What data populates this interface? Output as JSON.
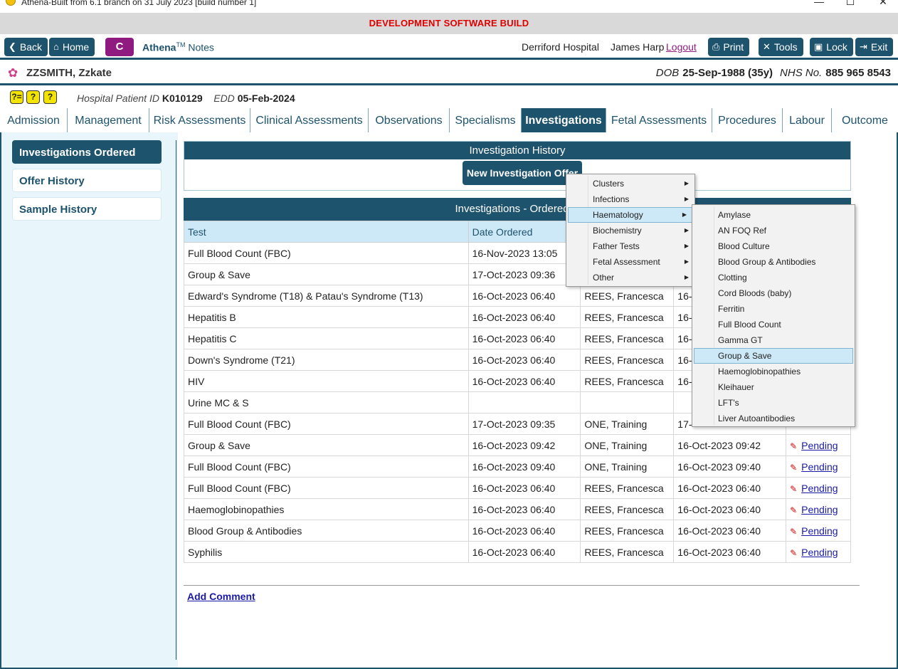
{
  "window": {
    "title": "Athena-Built from 6.1 branch on 31 July 2023 [build number 1]",
    "minimize": "—",
    "maximize": "☐",
    "close": "✕"
  },
  "banner": "DEVELOPMENT SOFTWARE BUILD",
  "toolbar": {
    "back": "Back",
    "home": "Home",
    "c": "C",
    "app_name": "Athena",
    "app_tm": "TM",
    "app_suffix": " Notes",
    "hospital": "Derriford Hospital",
    "user": "James Harp",
    "logout": "Logout",
    "print": "Print",
    "tools": "Tools",
    "lock": "Lock",
    "exit": "Exit"
  },
  "patient": {
    "name": "ZZSMITH, Zzkate",
    "dob_label": "DOB",
    "dob": "25-Sep-1988 (35y)",
    "nhs_label": "NHS No.",
    "nhs": "885 965 8543",
    "pid_label": "Hospital Patient ID",
    "pid": "K010129",
    "edd_label": "EDD",
    "edd": "05-Feb-2024",
    "icons": [
      "?=",
      "?",
      "?"
    ]
  },
  "tabs": [
    {
      "label": "Admission"
    },
    {
      "label": "Management"
    },
    {
      "label": "Risk Assessments"
    },
    {
      "label": "Clinical Assessments"
    },
    {
      "label": "Observations"
    },
    {
      "label": "Specialisms"
    },
    {
      "label": "Investigations"
    },
    {
      "label": "Fetal Assessments"
    },
    {
      "label": "Procedures"
    },
    {
      "label": "Labour"
    },
    {
      "label": "Outcome"
    }
  ],
  "sidebar": {
    "items": [
      {
        "label": "Investigations Ordered"
      },
      {
        "label": "Offer History"
      },
      {
        "label": "Sample History"
      }
    ]
  },
  "history": {
    "header": "Investigation History",
    "new_button": "New Investigation Offer"
  },
  "ordered": {
    "header": "Investigations - Ordered H",
    "columns": [
      "Test",
      "Date Ordered"
    ],
    "rows": [
      {
        "test": "Full Blood Count (FBC)",
        "date": "16-Nov-2023 13:05",
        "by": "",
        "date2": "",
        "status": ""
      },
      {
        "test": "Group & Save",
        "date": "17-Oct-2023 09:36",
        "by": "",
        "date2": "",
        "status": ""
      },
      {
        "test": "Edward's Syndrome (T18) & Patau's Syndrome (T13)",
        "date": "16-Oct-2023 06:40",
        "by": "REES, Francesca",
        "date2": "16-",
        "status": ""
      },
      {
        "test": "Hepatitis B",
        "date": "16-Oct-2023 06:40",
        "by": "REES, Francesca",
        "date2": "16-",
        "status": ""
      },
      {
        "test": "Hepatitis C",
        "date": "16-Oct-2023 06:40",
        "by": "REES, Francesca",
        "date2": "16-",
        "status": ""
      },
      {
        "test": "Down's Syndrome (T21)",
        "date": "16-Oct-2023 06:40",
        "by": "REES, Francesca",
        "date2": "16-",
        "status": ""
      },
      {
        "test": "HIV",
        "date": "16-Oct-2023 06:40",
        "by": "REES, Francesca",
        "date2": "16-",
        "status": ""
      },
      {
        "test": "Urine MC & S",
        "date": "",
        "by": "",
        "date2": "",
        "status": ""
      },
      {
        "test": "Full Blood Count (FBC)",
        "date": "17-Oct-2023 09:35",
        "by": "ONE, Training",
        "date2": "17-",
        "status": ""
      },
      {
        "test": "Group & Save",
        "date": "16-Oct-2023 09:42",
        "by": "ONE, Training",
        "date2": "16-Oct-2023 09:42",
        "status": "Pending"
      },
      {
        "test": "Full Blood Count (FBC)",
        "date": "16-Oct-2023 09:40",
        "by": "ONE, Training",
        "date2": "16-Oct-2023 09:40",
        "status": "Pending"
      },
      {
        "test": "Full Blood Count (FBC)",
        "date": "16-Oct-2023 06:40",
        "by": "REES, Francesca",
        "date2": "16-Oct-2023 06:40",
        "status": "Pending"
      },
      {
        "test": "Haemoglobinopathies",
        "date": "16-Oct-2023 06:40",
        "by": "REES, Francesca",
        "date2": "16-Oct-2023 06:40",
        "status": "Pending"
      },
      {
        "test": "Blood Group & Antibodies",
        "date": "16-Oct-2023 06:40",
        "by": "REES, Francesca",
        "date2": "16-Oct-2023 06:40",
        "status": "Pending"
      },
      {
        "test": "Syphilis",
        "date": "16-Oct-2023 06:40",
        "by": "REES, Francesca",
        "date2": "16-Oct-2023 06:40",
        "status": "Pending"
      }
    ]
  },
  "add_comment": "Add Comment",
  "menu": {
    "items": [
      {
        "label": "Clusters",
        "submenu": true
      },
      {
        "label": "Infections",
        "submenu": true
      },
      {
        "label": "Haematology",
        "submenu": true,
        "hover": true
      },
      {
        "label": "Biochemistry",
        "submenu": true
      },
      {
        "label": "Father Tests",
        "submenu": true
      },
      {
        "label": "Fetal Assessment",
        "submenu": true
      },
      {
        "label": "Other",
        "submenu": true
      }
    ],
    "submenu_items": [
      {
        "label": "Amylase"
      },
      {
        "label": "AN FOQ Ref"
      },
      {
        "label": "Blood Culture"
      },
      {
        "label": "Blood Group & Antibodies"
      },
      {
        "label": "Clotting"
      },
      {
        "label": "Cord Bloods (baby)"
      },
      {
        "label": "Ferritin"
      },
      {
        "label": "Full Blood Count"
      },
      {
        "label": "Gamma GT"
      },
      {
        "label": "Group & Save",
        "hover": true
      },
      {
        "label": "Haemoglobinopathies"
      },
      {
        "label": "Kleihauer"
      },
      {
        "label": "LFT's"
      },
      {
        "label": "Liver Autoantibodies"
      }
    ]
  },
  "colors": {
    "primary": "#1e536d",
    "accent": "#8f1a80",
    "banner_text": "#e00000",
    "content_bg": "#e8f5fb"
  }
}
